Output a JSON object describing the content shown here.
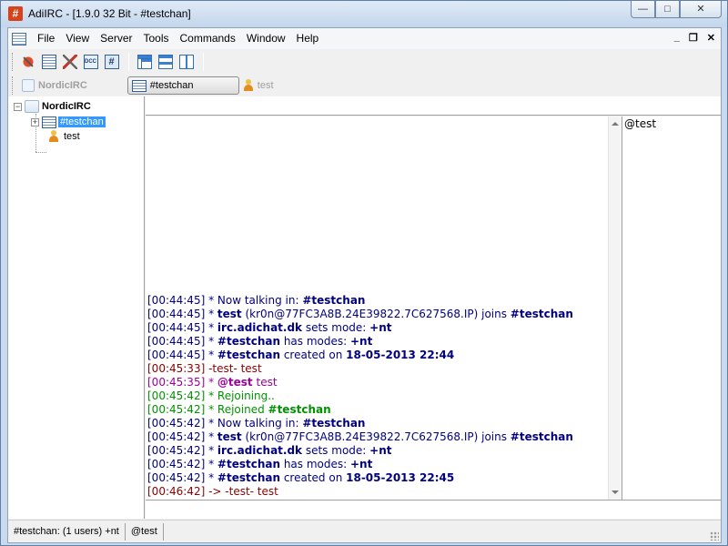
{
  "window": {
    "title": "AdiIRC - [1.9.0 32 Bit - #testchan]",
    "app_icon_glyph": "#",
    "buttons": {
      "minimize": "—",
      "maximize": "□",
      "close": "✕"
    }
  },
  "menubar": {
    "items": [
      "File",
      "View",
      "Server",
      "Tools",
      "Commands",
      "Window",
      "Help"
    ],
    "mdi_buttons": {
      "minimize": "_",
      "restore": "❐",
      "close": "✕"
    }
  },
  "toolbar": {
    "icons": [
      "disconnect-icon",
      "channel-list-icon",
      "tools-icon",
      "dcc-icon",
      "channel-icon",
      "cascade-windows-icon",
      "tile-horizontal-icon",
      "tile-vertical-icon"
    ],
    "dcc_label": "DCC",
    "hash_label": "#"
  },
  "tabs": [
    {
      "label": "NordicIRC",
      "type": "server"
    },
    {
      "label": "#testchan",
      "type": "channel",
      "active": true
    },
    {
      "label": "test",
      "type": "query"
    }
  ],
  "tree": {
    "server": "NordicIRC",
    "channel": "#testchan",
    "query": "test",
    "expand_minus": "−",
    "expand_plus": "+"
  },
  "chat": {
    "lines": [
      {
        "time": "[00:44:45]",
        "color": "navy",
        "parts": [
          [
            "* Now talking in: ",
            0
          ],
          [
            "#testchan",
            1
          ]
        ]
      },
      {
        "time": "[00:44:45]",
        "color": "navy",
        "parts": [
          [
            "* ",
            0
          ],
          [
            "test",
            1
          ],
          [
            " (kr0n@77FC3A8B.24E39822.7C627568.IP) joins ",
            0
          ],
          [
            "#testchan",
            1
          ]
        ]
      },
      {
        "time": "[00:44:45]",
        "color": "navy",
        "parts": [
          [
            "* ",
            0
          ],
          [
            "irc.adichat.dk",
            1
          ],
          [
            " sets mode: ",
            0
          ],
          [
            "+nt",
            1
          ]
        ]
      },
      {
        "time": "[00:44:45]",
        "color": "navy",
        "parts": [
          [
            "* ",
            0
          ],
          [
            "#testchan",
            1
          ],
          [
            " has modes: ",
            0
          ],
          [
            "+nt",
            1
          ]
        ]
      },
      {
        "time": "[00:44:45]",
        "color": "navy",
        "parts": [
          [
            "* ",
            0
          ],
          [
            "#testchan",
            1
          ],
          [
            " created on ",
            0
          ],
          [
            "18-05-2013 22:44",
            1
          ]
        ]
      },
      {
        "time": "[00:45:33]",
        "color": "maroon",
        "parts": [
          [
            "-test- test",
            0
          ]
        ]
      },
      {
        "time": "[00:45:35]",
        "color": "purple",
        "parts": [
          [
            "* ",
            0
          ],
          [
            "@test",
            1
          ],
          [
            " test",
            0
          ]
        ]
      },
      {
        "time": "[00:45:42]",
        "color": "green",
        "parts": [
          [
            "* Rejoining..",
            0
          ]
        ]
      },
      {
        "time": "[00:45:42]",
        "color": "green",
        "parts": [
          [
            "* Rejoined ",
            0
          ],
          [
            "#testchan",
            1
          ]
        ]
      },
      {
        "time": "[00:45:42]",
        "color": "navy",
        "parts": [
          [
            "* Now talking in: ",
            0
          ],
          [
            "#testchan",
            1
          ]
        ]
      },
      {
        "time": "[00:45:42]",
        "color": "navy",
        "parts": [
          [
            "* ",
            0
          ],
          [
            "test",
            1
          ],
          [
            " (kr0n@77FC3A8B.24E39822.7C627568.IP) joins ",
            0
          ],
          [
            "#testchan",
            1
          ]
        ]
      },
      {
        "time": "[00:45:42]",
        "color": "navy",
        "parts": [
          [
            "* ",
            0
          ],
          [
            "irc.adichat.dk",
            1
          ],
          [
            " sets mode: ",
            0
          ],
          [
            "+nt",
            1
          ]
        ]
      },
      {
        "time": "[00:45:42]",
        "color": "navy",
        "parts": [
          [
            "* ",
            0
          ],
          [
            "#testchan",
            1
          ],
          [
            " has modes: ",
            0
          ],
          [
            "+nt",
            1
          ]
        ]
      },
      {
        "time": "[00:45:42]",
        "color": "navy",
        "parts": [
          [
            "* ",
            0
          ],
          [
            "#testchan",
            1
          ],
          [
            " created on ",
            0
          ],
          [
            "18-05-2013 22:45",
            1
          ]
        ]
      },
      {
        "time": "[00:46:42]",
        "color": "maroon",
        "parts": [
          [
            "-> -test- test",
            0
          ]
        ]
      }
    ]
  },
  "nicklist": [
    "@test"
  ],
  "statusbar": {
    "channel_info": "#testchan: (1 users) +nt",
    "nick": "@test"
  },
  "colors": {
    "navy": "#000080",
    "maroon": "#8b0000",
    "purple": "#9c009c",
    "green": "#009300",
    "selection": "#3399ff"
  }
}
